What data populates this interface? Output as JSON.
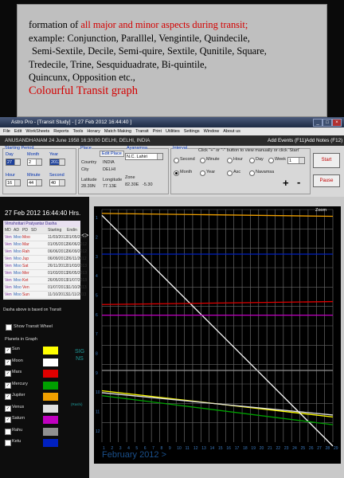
{
  "caption": {
    "line1_prefix": "formation of",
    "line1_red": "all major and minor aspects during transit;",
    "line2": "example:  Conjunction, Paralllel, Vengintile, Quindecile,",
    "line3": "Semi-Sextile, Decile, Semi-quire, Sextile, Qunitile, Square,",
    "line4": "Tredecile, Trine, Sesquiduadrate, Bi-quintile,",
    "line5": "Quincunx, Opposition etc.,",
    "line6": "Colourful Transit graph"
  },
  "window": {
    "title": "Astro Pro - [Transit Study] - [ 27 Feb 2012 16:44:40 ]",
    "menu": [
      "File",
      "Edit",
      "WorkSheets",
      "Reports",
      "Tools",
      "Horary",
      "Match Making",
      "Transit",
      "Print",
      "Utilities",
      "Settings",
      "Window",
      "About us"
    ],
    "info": "ANUSANDHANAM  24 June 1958  16:30:00  DELHI, DELHI, INDIA",
    "add_events": "Add Events (F11)",
    "add_notes": "Add Notes (F12)"
  },
  "period": {
    "title": "Starting Period",
    "day_label": "Day",
    "day": "27",
    "month_label": "Month",
    "month": "2",
    "year_label": "Year",
    "year": "2012",
    "hour_label": "Hour",
    "hour": "16",
    "minute_label": "Minute",
    "minute": "44",
    "second_label": "Second",
    "second": "40"
  },
  "place": {
    "title": "Place",
    "edit": "Edit Place",
    "country_label": "Country",
    "country": "INDIA",
    "city_label": "City",
    "city": "DELHI",
    "lat_label": "Latitude",
    "lat": "28.39N",
    "lon_label": "Longitude",
    "lon": "77.13E",
    "zone_label": "Zone",
    "zone": "82.30E",
    "zone2": "-5.30",
    "ayan_label": "Ayanamsa",
    "ayan": "N.C. Lahiri"
  },
  "interval": {
    "title": "Interval",
    "hint": "Click \"+\" or \"-\" button to view manually or click 'Start'",
    "opts": [
      "Second",
      "Minute",
      "Hour",
      "Day",
      "Week",
      "Month",
      "Year",
      "Asc",
      "Navamsa"
    ],
    "value": "1",
    "plus": "+",
    "minus": "-",
    "start": "Start",
    "pause": "Pause"
  },
  "left": {
    "datetime": "27 Feb 2012  16:44:40 Hrs.",
    "dasha_title": "Vimshottari Pratyantar Dasha",
    "dasha_headers": [
      "MD",
      "AD",
      "PD",
      "SD",
      "Starting",
      "Endin"
    ],
    "dasha_rows": [
      [
        "Ven",
        "Moo",
        "Moo",
        "",
        "11/03/2012",
        "01/05/2012"
      ],
      [
        "Ven",
        "Moo",
        "Mar",
        "",
        "01/05/2012",
        "06/06/2012"
      ],
      [
        "Ven",
        "Moo",
        "Rah",
        "",
        "06/06/2012",
        "06/09/2012"
      ],
      [
        "Ven",
        "Moo",
        "Jup",
        "",
        "06/09/2012",
        "26/11/2012"
      ],
      [
        "Ven",
        "Moo",
        "Sat",
        "",
        "26/11/2012",
        "01/03/2013"
      ],
      [
        "Ven",
        "Moo",
        "Mer",
        "",
        "01/03/2013",
        "26/05/2013"
      ],
      [
        "Ven",
        "Moo",
        "Ket",
        "",
        "26/05/2013",
        "01/07/2013"
      ],
      [
        "Ven",
        "Moo",
        "Ven",
        "",
        "01/07/2013",
        "11/10/2013"
      ],
      [
        "Ven",
        "Moo",
        "Sun",
        "",
        "11/10/2013",
        "11/11/2013"
      ]
    ],
    "dasha_note": "Dasha above is based on Transit",
    "show_wheel": "Show Transit Wheel",
    "planets_title": "Planets in Graph",
    "signs_label": "SIGNS",
    "rashi_label": "(Rashi)",
    "planets": [
      {
        "name": "Sun",
        "color": "#ffff00",
        "checked": true
      },
      {
        "name": "Moon",
        "color": "#ffffff",
        "checked": true
      },
      {
        "name": "Mars",
        "color": "#e00000",
        "checked": true
      },
      {
        "name": "Mercury",
        "color": "#00a000",
        "checked": true
      },
      {
        "name": "Jupiter",
        "color": "#f0a000",
        "checked": true
      },
      {
        "name": "Venus",
        "color": "#e0e0e0",
        "checked": true
      },
      {
        "name": "Saturn",
        "color": "#c000c0",
        "checked": true
      },
      {
        "name": "Rahu",
        "color": "#909090",
        "checked": false
      },
      {
        "name": "Ketu",
        "color": "#0020c0",
        "checked": false
      }
    ]
  },
  "graph": {
    "zoom": "Zoom",
    "month_label": "February 2012 >",
    "y_ticks": [
      "1",
      "2",
      "3",
      "4",
      "5",
      "6",
      "7",
      "8",
      "9",
      "10",
      "11",
      "12"
    ],
    "x_ticks": [
      "1",
      "2",
      "3",
      "4",
      "5",
      "6",
      "7",
      "8",
      "9",
      "10",
      "11",
      "12",
      "13",
      "14",
      "15",
      "16",
      "17",
      "18",
      "19",
      "20",
      "21",
      "22",
      "23",
      "24",
      "25",
      "26",
      "27",
      "28",
      "29"
    ]
  },
  "chart_data": {
    "type": "line",
    "x": [
      1,
      29
    ],
    "ylim": [
      1,
      13
    ],
    "xlabel": "February 2012 >",
    "series": [
      {
        "color": "#f0a000",
        "values": [
          1.2,
          1.35
        ]
      },
      {
        "color": "#ffff00",
        "values": [
          10.35,
          11.7
        ]
      },
      {
        "color": "#ffffff",
        "values": [
          1.3,
          13.2
        ]
      },
      {
        "color": "#e00000",
        "values": [
          5.9,
          5.75
        ]
      },
      {
        "color": "#c000c0",
        "values": [
          6.45,
          6.45
        ]
      },
      {
        "color": "#e0e0e0",
        "values": [
          10.45,
          11.6
        ]
      },
      {
        "color": "#00a000",
        "values": [
          10.6,
          12.1
        ]
      },
      {
        "color": "#0020c0",
        "values": [
          3.3,
          3.3
        ]
      },
      {
        "color": "#909090",
        "values": [
          9.3,
          9.3
        ]
      }
    ]
  }
}
